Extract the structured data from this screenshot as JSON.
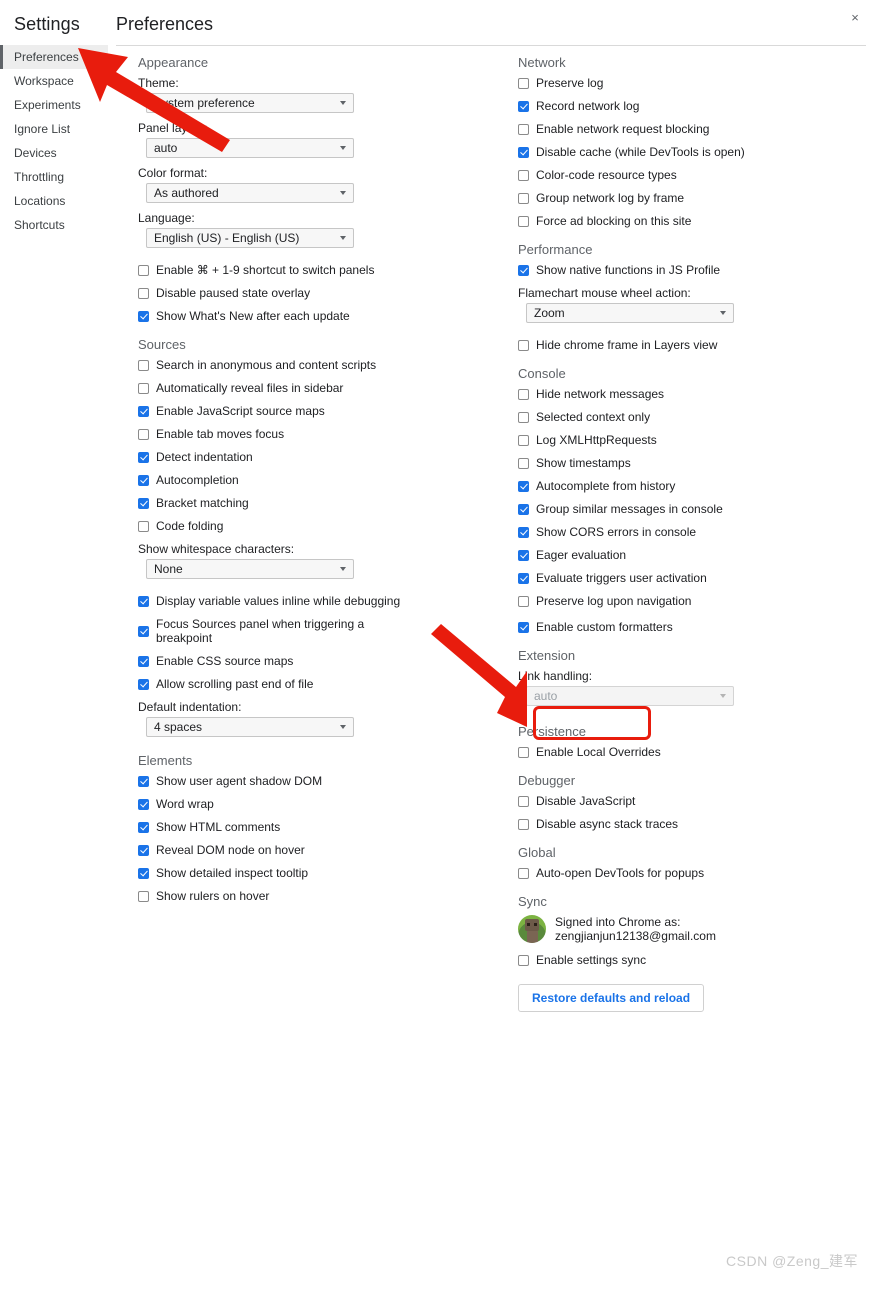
{
  "window": {
    "close_icon": "×"
  },
  "sidebar": {
    "title": "Settings",
    "items": [
      {
        "label": "Preferences",
        "selected": true
      },
      {
        "label": "Workspace",
        "selected": false
      },
      {
        "label": "Experiments",
        "selected": false
      },
      {
        "label": "Ignore List",
        "selected": false
      },
      {
        "label": "Devices",
        "selected": false
      },
      {
        "label": "Throttling",
        "selected": false
      },
      {
        "label": "Locations",
        "selected": false
      },
      {
        "label": "Shortcuts",
        "selected": false
      }
    ]
  },
  "main": {
    "title": "Preferences"
  },
  "appearance": {
    "title": "Appearance",
    "theme_label": "Theme:",
    "theme_value": "System preference",
    "panel_layout_label": "Panel layout:",
    "panel_layout_value": "auto",
    "color_format_label": "Color format:",
    "color_format_value": "As authored",
    "language_label": "Language:",
    "language_value": "English (US) - English (US)",
    "checkboxes": [
      {
        "label": "Enable ⌘ + 1-9 shortcut to switch panels",
        "checked": false
      },
      {
        "label": "Disable paused state overlay",
        "checked": false
      },
      {
        "label": "Show What's New after each update",
        "checked": true
      }
    ]
  },
  "sources": {
    "title": "Sources",
    "checkboxes_top": [
      {
        "label": "Search in anonymous and content scripts",
        "checked": false
      },
      {
        "label": "Automatically reveal files in sidebar",
        "checked": false
      },
      {
        "label": "Enable JavaScript source maps",
        "checked": true
      },
      {
        "label": "Enable tab moves focus",
        "checked": false
      },
      {
        "label": "Detect indentation",
        "checked": true
      },
      {
        "label": "Autocompletion",
        "checked": true
      },
      {
        "label": "Bracket matching",
        "checked": true
      },
      {
        "label": "Code folding",
        "checked": false
      }
    ],
    "whitespace_label": "Show whitespace characters:",
    "whitespace_value": "None",
    "checkboxes_mid": [
      {
        "label": "Display variable values inline while debugging",
        "checked": true
      },
      {
        "label": "Focus Sources panel when triggering a breakpoint",
        "checked": true
      },
      {
        "label": "Enable CSS source maps",
        "checked": true
      },
      {
        "label": "Allow scrolling past end of file",
        "checked": true
      }
    ],
    "indentation_label": "Default indentation:",
    "indentation_value": "4 spaces"
  },
  "elements": {
    "title": "Elements",
    "checkboxes": [
      {
        "label": "Show user agent shadow DOM",
        "checked": true
      },
      {
        "label": "Word wrap",
        "checked": true
      },
      {
        "label": "Show HTML comments",
        "checked": true
      },
      {
        "label": "Reveal DOM node on hover",
        "checked": true
      },
      {
        "label": "Show detailed inspect tooltip",
        "checked": true
      },
      {
        "label": "Show rulers on hover",
        "checked": false
      }
    ]
  },
  "network": {
    "title": "Network",
    "checkboxes": [
      {
        "label": "Preserve log",
        "checked": false
      },
      {
        "label": "Record network log",
        "checked": true
      },
      {
        "label": "Enable network request blocking",
        "checked": false
      },
      {
        "label": "Disable cache (while DevTools is open)",
        "checked": true
      },
      {
        "label": "Color-code resource types",
        "checked": false
      },
      {
        "label": "Group network log by frame",
        "checked": false
      },
      {
        "label": "Force ad blocking on this site",
        "checked": false
      }
    ]
  },
  "performance": {
    "title": "Performance",
    "checkboxes_top": [
      {
        "label": "Show native functions in JS Profile",
        "checked": true
      }
    ],
    "flamechart_label": "Flamechart mouse wheel action:",
    "flamechart_value": "Zoom",
    "checkboxes_bottom": [
      {
        "label": "Hide chrome frame in Layers view",
        "checked": false
      }
    ]
  },
  "console": {
    "title": "Console",
    "checkboxes": [
      {
        "label": "Hide network messages",
        "checked": false
      },
      {
        "label": "Selected context only",
        "checked": false
      },
      {
        "label": "Log XMLHttpRequests",
        "checked": false
      },
      {
        "label": "Show timestamps",
        "checked": false
      },
      {
        "label": "Autocomplete from history",
        "checked": true
      },
      {
        "label": "Group similar messages in console",
        "checked": true
      },
      {
        "label": "Show CORS errors in console",
        "checked": true
      },
      {
        "label": "Eager evaluation",
        "checked": true
      },
      {
        "label": "Evaluate triggers user activation",
        "checked": true
      },
      {
        "label": "Preserve log upon navigation",
        "checked": false
      },
      {
        "label": "Enable custom formatters",
        "checked": true
      }
    ]
  },
  "extension": {
    "title": "Extension",
    "link_handling_label": "Link handling:",
    "link_handling_value": "auto",
    "link_handling_disabled": true
  },
  "persistence": {
    "title": "Persistence",
    "checkboxes": [
      {
        "label": "Enable Local Overrides",
        "checked": false
      }
    ]
  },
  "debugger": {
    "title": "Debugger",
    "checkboxes": [
      {
        "label": "Disable JavaScript",
        "checked": false
      },
      {
        "label": "Disable async stack traces",
        "checked": false
      }
    ]
  },
  "global": {
    "title": "Global",
    "checkboxes": [
      {
        "label": "Auto-open DevTools for popups",
        "checked": false
      }
    ]
  },
  "sync": {
    "title": "Sync",
    "signed_in_line1": "Signed into Chrome as:",
    "signed_in_line2": "zengjianjun12138@gmail.com",
    "checkboxes": [
      {
        "label": "Enable settings sync",
        "checked": false
      }
    ],
    "restore_button": "Restore defaults and reload"
  },
  "annotations": {
    "accent_color": "#e81c0d",
    "highlight_target": "Enable custom formatters",
    "arrow_top_target": "Preferences",
    "arrow_bottom_target": "Enable custom formatters"
  },
  "watermark": "CSDN @Zeng_建军"
}
